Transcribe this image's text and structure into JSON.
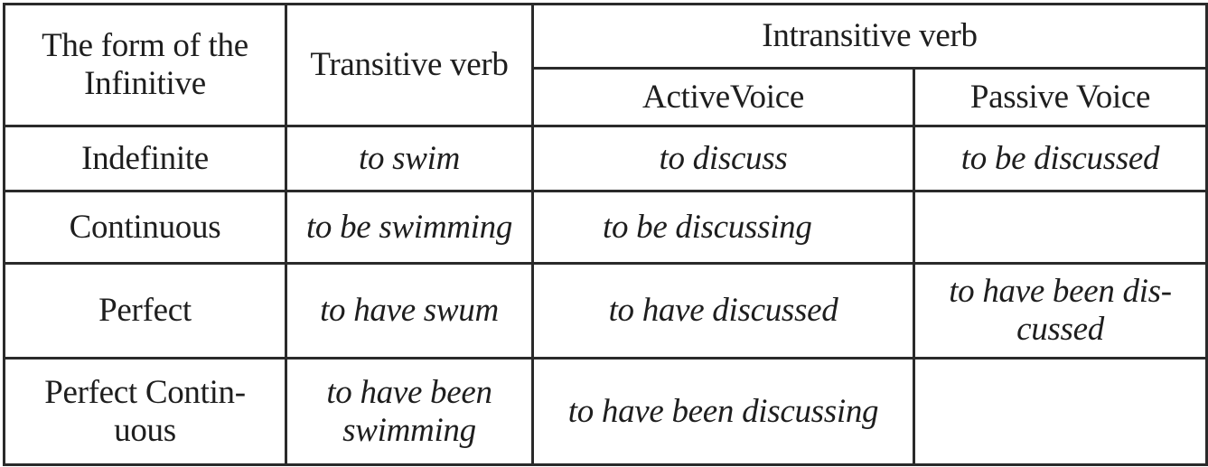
{
  "table": {
    "headers": {
      "form": [
        "The form of the",
        "Infinitive"
      ],
      "transitive": "Transitive verb",
      "intransitive": "Intransitive verb",
      "active": "ActiveVoice",
      "passive": "Passive Voice"
    },
    "rows": [
      {
        "form": [
          "Indefinite"
        ],
        "transitive": [
          "to swim"
        ],
        "active": [
          "to discuss"
        ],
        "passive": [
          "to be discussed"
        ]
      },
      {
        "form": [
          "Continuous"
        ],
        "transitive": [
          "to be swimming"
        ],
        "active": [
          "to be discussing"
        ],
        "passive": []
      },
      {
        "form": [
          "Perfect"
        ],
        "transitive": [
          "to have swum"
        ],
        "active": [
          "to have discussed"
        ],
        "passive": [
          "to have been dis-",
          "cussed"
        ]
      },
      {
        "form": [
          "Perfect Contin-",
          "uous"
        ],
        "transitive": [
          "to have been",
          "swimming"
        ],
        "active": [
          "to have been discussing"
        ],
        "passive": []
      }
    ]
  }
}
